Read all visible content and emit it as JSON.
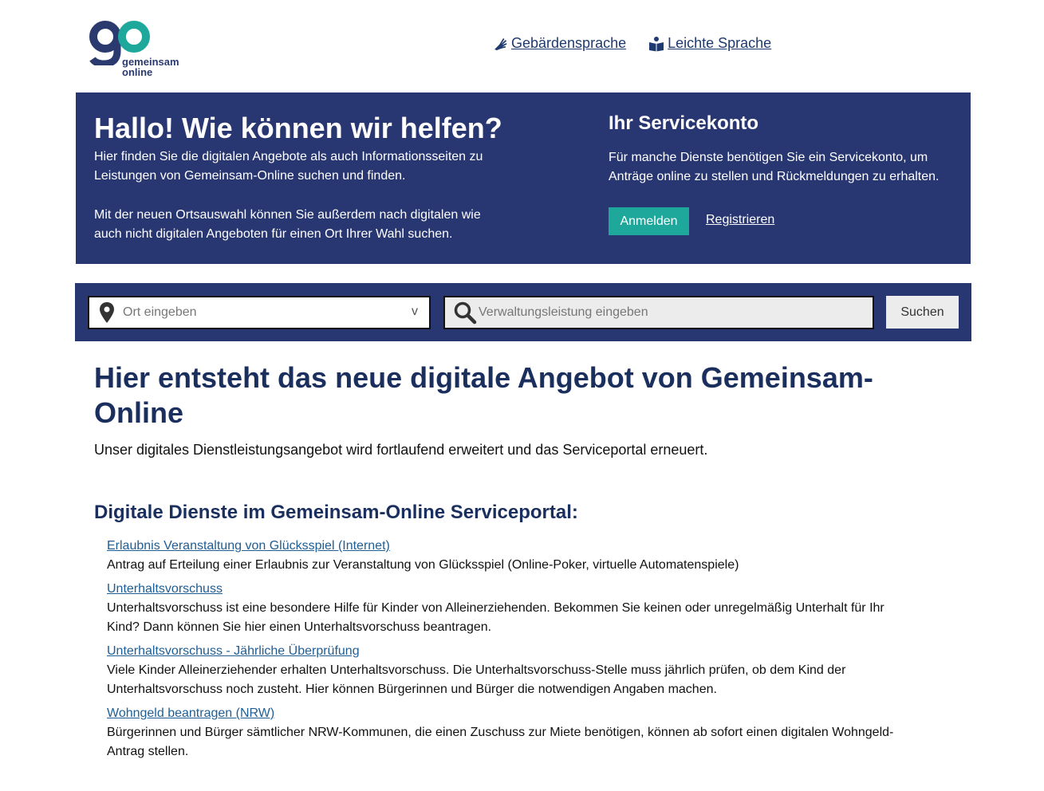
{
  "header": {
    "logo": {
      "mark": "go",
      "line1": "gemeinsam",
      "line2": "online"
    },
    "links": [
      {
        "label": "Gebärdensprache",
        "icon": "sign-language-icon"
      },
      {
        "label": "Leichte Sprache",
        "icon": "easy-language-icon"
      }
    ]
  },
  "hero": {
    "title": "Hallo! Wie können wir helfen?",
    "text1": "Hier finden Sie die digitalen Angebote als auch Informationsseiten zu Leistungen von Gemeinsam-Online suchen und finden.",
    "text2": "Mit der neuen Ortsauswahl können Sie außerdem nach digitalen wie auch nicht digitalen Angeboten für einen Ort Ihrer Wahl suchen.",
    "servicekonto": {
      "title": "Ihr Servicekonto",
      "text": "Für manche Dienste benötigen Sie ein Servicekonto, um Anträge online zu stellen und Rückmeldungen zu erhalten.",
      "login_label": "Anmelden",
      "register_label": "Registrieren"
    }
  },
  "search": {
    "location_placeholder": "Ort eingeben",
    "location_chevron": "v",
    "service_placeholder": "Verwaltungsleistung eingeben",
    "submit_label": "Suchen"
  },
  "main": {
    "title": "Hier entsteht das neue digitale Angebot von Gemeinsam-Online",
    "subtitle": "Unser digitales Dienstleistungsangebot wird fortlaufend erweitert und das Serviceportal erneuert.",
    "section_title": "Digitale Dienste im Gemeinsam-Online Serviceportal:",
    "services": [
      {
        "title": "Erlaubnis Veranstaltung von Glücksspiel (Internet)",
        "description": "Antrag auf Erteilung einer Erlaubnis zur Veranstaltung von Glücksspiel (Online-Poker, virtuelle Automatenspiele)"
      },
      {
        "title": "Unterhaltsvorschuss",
        "description": "Unterhaltsvorschuss ist eine besondere Hilfe für Kinder von Alleinerziehenden. Bekommen Sie keinen oder unregelmäßig Unterhalt für Ihr Kind? Dann können Sie hier einen Unterhaltsvorschuss beantragen."
      },
      {
        "title": "Unterhaltsvorschuss - Jährliche Überprüfung",
        "description": "Viele Kinder Alleinerziehender erhalten Unterhaltsvorschuss. Die Unterhaltsvorschuss-Stelle muss jährlich prüfen, ob dem Kind der Unterhaltsvorschuss noch zusteht. Hier können Bürgerinnen und Bürger die notwendigen Angaben machen."
      },
      {
        "title": "Wohngeld beantragen (NRW)",
        "description": "Bürgerinnen und Bürger sämtlicher NRW-Kommunen, die einen Zuschuss zur Miete benötigen, können ab sofort einen digitalen Wohngeld-Antrag stellen."
      }
    ]
  },
  "colors": {
    "hero_bg": "#283671",
    "accent_button": "#1ea89c",
    "logo_teal": "#1ea89c",
    "logo_navy": "#2b3a6e",
    "heading": "#1b2f5e",
    "link": "#1f5e94"
  }
}
